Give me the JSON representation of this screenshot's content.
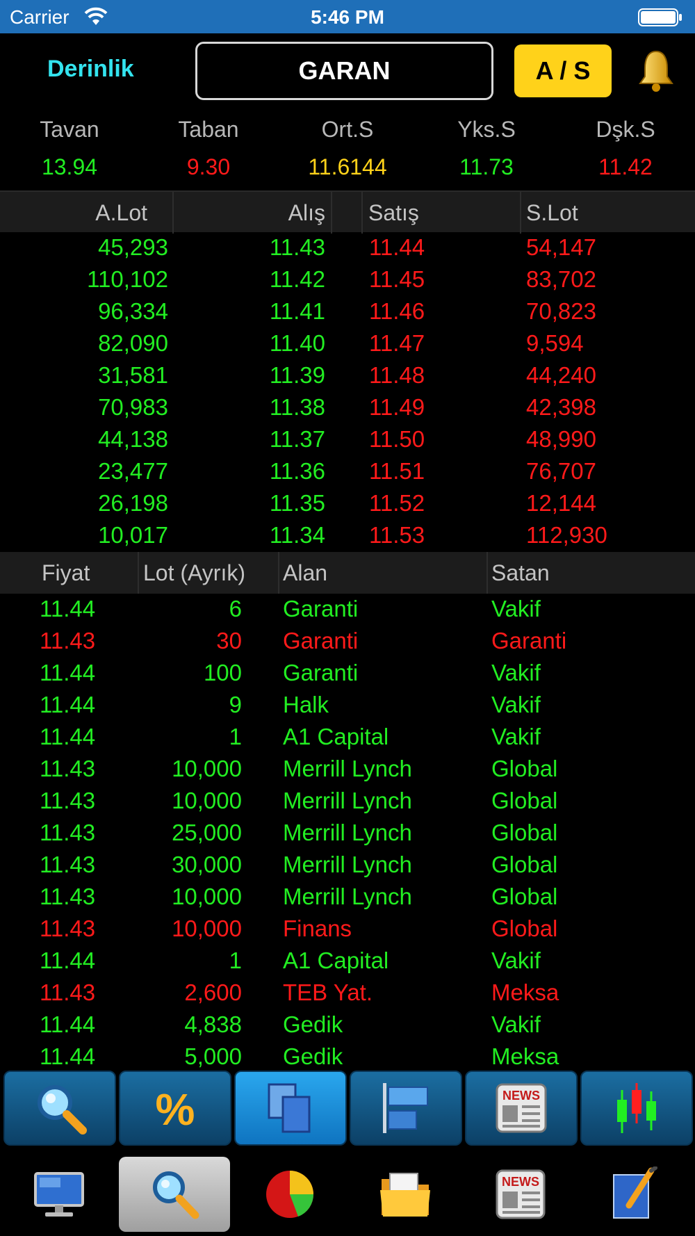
{
  "status_bar": {
    "carrier": "Carrier",
    "time": "5:46 PM"
  },
  "header": {
    "mode_label": "Derinlik",
    "symbol": "GARAN",
    "buy_sell_label": "A / S"
  },
  "summary": [
    {
      "label": "Tavan",
      "value": "13.94",
      "color": "#22ee22"
    },
    {
      "label": "Taban",
      "value": "9.30",
      "color": "#ff1a1a"
    },
    {
      "label": "Ort.S",
      "value": "11.6144",
      "color": "#ffd21a"
    },
    {
      "label": "Yks.S",
      "value": "11.73",
      "color": "#22ee22"
    },
    {
      "label": "Dşk.S",
      "value": "11.42",
      "color": "#ff1a1a"
    }
  ],
  "depth": {
    "columns": [
      "A.Lot",
      "Alış",
      "Satış",
      "S.Lot"
    ],
    "rows": [
      [
        "45,293",
        "11.43",
        "11.44",
        "54,147"
      ],
      [
        "110,102",
        "11.42",
        "11.45",
        "83,702"
      ],
      [
        "96,334",
        "11.41",
        "11.46",
        "70,823"
      ],
      [
        "82,090",
        "11.40",
        "11.47",
        "9,594"
      ],
      [
        "31,581",
        "11.39",
        "11.48",
        "44,240"
      ],
      [
        "70,983",
        "11.38",
        "11.49",
        "42,398"
      ],
      [
        "44,138",
        "11.37",
        "11.50",
        "48,990"
      ],
      [
        "23,477",
        "11.36",
        "11.51",
        "76,707"
      ],
      [
        "26,198",
        "11.35",
        "11.52",
        "12,144"
      ],
      [
        "10,017",
        "11.34",
        "11.53",
        "112,930"
      ]
    ]
  },
  "trades": {
    "columns": [
      "Fiyat",
      "Lot (Ayrık)",
      "Alan",
      "Satan"
    ],
    "rows": [
      {
        "price": "11.44",
        "lot": "6",
        "buyer": "Garanti",
        "seller": "Vakif",
        "side": "buy"
      },
      {
        "price": "11.43",
        "lot": "30",
        "buyer": "Garanti",
        "seller": "Garanti",
        "side": "sell"
      },
      {
        "price": "11.44",
        "lot": "100",
        "buyer": "Garanti",
        "seller": "Vakif",
        "side": "buy"
      },
      {
        "price": "11.44",
        "lot": "9",
        "buyer": "Halk",
        "seller": "Vakif",
        "side": "buy"
      },
      {
        "price": "11.44",
        "lot": "1",
        "buyer": "A1 Capital",
        "seller": "Vakif",
        "side": "buy"
      },
      {
        "price": "11.43",
        "lot": "10,000",
        "buyer": "Merrill Lynch",
        "seller": "Global",
        "side": "buy"
      },
      {
        "price": "11.43",
        "lot": "10,000",
        "buyer": "Merrill Lynch",
        "seller": "Global",
        "side": "buy"
      },
      {
        "price": "11.43",
        "lot": "25,000",
        "buyer": "Merrill Lynch",
        "seller": "Global",
        "side": "buy"
      },
      {
        "price": "11.43",
        "lot": "30,000",
        "buyer": "Merrill Lynch",
        "seller": "Global",
        "side": "buy"
      },
      {
        "price": "11.43",
        "lot": "10,000",
        "buyer": "Merrill Lynch",
        "seller": "Global",
        "side": "buy"
      },
      {
        "price": "11.43",
        "lot": "10,000",
        "buyer": "Finans",
        "seller": "Global",
        "side": "sell"
      },
      {
        "price": "11.44",
        "lot": "1",
        "buyer": "A1 Capital",
        "seller": "Vakif",
        "side": "buy"
      },
      {
        "price": "11.43",
        "lot": "2,600",
        "buyer": "TEB Yat.",
        "seller": "Meksa",
        "side": "sell"
      },
      {
        "price": "11.44",
        "lot": "4,838",
        "buyer": "Gedik",
        "seller": "Vakif",
        "side": "buy"
      },
      {
        "price": "11.44",
        "lot": "5,000",
        "buyer": "Gedik",
        "seller": "Meksa",
        "side": "buy"
      }
    ]
  },
  "toolbar": {
    "items": [
      "search-icon",
      "percent-icon",
      "copy-pages-icon",
      "bar-align-icon",
      "news-icon",
      "candlestick-icon"
    ],
    "percent_glyph": "%",
    "news_glyph": "NEWS",
    "active_index": 2
  },
  "tabbar": {
    "items": [
      "monitor-icon",
      "search-icon",
      "pie-chart-icon",
      "folder-icon",
      "news-icon",
      "edit-note-icon"
    ],
    "news_glyph": "NEWS",
    "active_index": 1
  },
  "colors": {
    "buy": "#22ee22",
    "sell": "#ff1a1a",
    "accent": "#33e3ee",
    "button": "#ffd21a",
    "status_bar": "#1f6fb8"
  }
}
